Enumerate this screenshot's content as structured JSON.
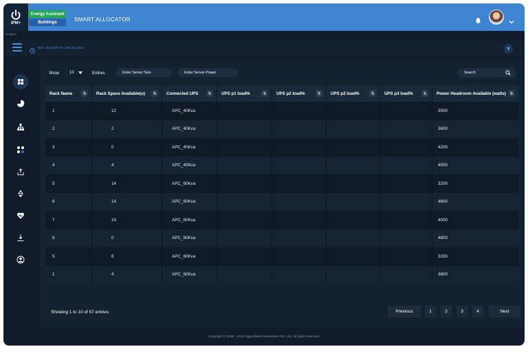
{
  "header": {
    "logo_text": "IPM+",
    "logo_sub": "TeDigiBot",
    "tag_energy": "Energy Assistant",
    "tag_buildings": "Buildings",
    "title": "SMART ALLOCATOR"
  },
  "subbar": {
    "date_range": "MAY 30,2019 TO JUN 29,2019"
  },
  "toolbar": {
    "show_label": "Show",
    "entries_value": "10",
    "entries_label": "Entries",
    "server_size_placeholder": "Enter Server Size",
    "server_power_placeholder": "Enter Server Power",
    "search_placeholder": "Search"
  },
  "table": {
    "columns": [
      "Rack Name",
      "Rack Space Available(u)",
      "Connected UPS",
      "UPS p1 load%",
      "UPS p2 load%",
      "UPS p2 load%",
      "UPS p3 load%",
      "Power Headroom Available (watts)"
    ],
    "rows": [
      [
        "1",
        "12",
        "APC_40Kva",
        "",
        "",
        "",
        "",
        "3500"
      ],
      [
        "2",
        "2",
        "APC_40Kva",
        "",
        "",
        "",
        "",
        "3600"
      ],
      [
        "3",
        "0",
        "APC_40Kva",
        "",
        "",
        "",
        "",
        "4200"
      ],
      [
        "4",
        "4",
        "APC_40Kva",
        "",
        "",
        "",
        "",
        "4500"
      ],
      [
        "5",
        "14",
        "APC_60Kva",
        "",
        "",
        "",
        "",
        "3200"
      ],
      [
        "6",
        "14",
        "APC_60Kva",
        "",
        "",
        "",
        "",
        "4600"
      ],
      [
        "7",
        "10",
        "APC_60Kva",
        "",
        "",
        "",
        "",
        "4000"
      ],
      [
        "8",
        "0",
        "APC_60Kva",
        "",
        "",
        "",
        "",
        "4800"
      ],
      [
        "5",
        "6",
        "APC_60Kva",
        "",
        "",
        "",
        "",
        "3200"
      ],
      [
        "1",
        "4",
        "APC_60Kva",
        "",
        "",
        "",
        "",
        "3800"
      ]
    ]
  },
  "footer": {
    "info": "Showing 1 to 10 of 57 entries",
    "previous": "Previous",
    "pages": [
      "1",
      "2",
      "3",
      "4"
    ],
    "next": "Next",
    "copyright": "Copyright © 2008 - 2019 Vigyanlabs Innovations Pvt. Ltd. All rights reserved."
  },
  "nav_icons": [
    "dashboard-icon",
    "pie-chart-icon",
    "hierarchy-icon",
    "allocation-icon",
    "upload-icon",
    "recycle-icon",
    "health-icon",
    "download-icon",
    "user-icon"
  ],
  "colors": {
    "header_blue": "#3f84d3",
    "energy_green": "#1fa84f",
    "accent_blue": "#4f90dc",
    "background": "#101c2a"
  }
}
